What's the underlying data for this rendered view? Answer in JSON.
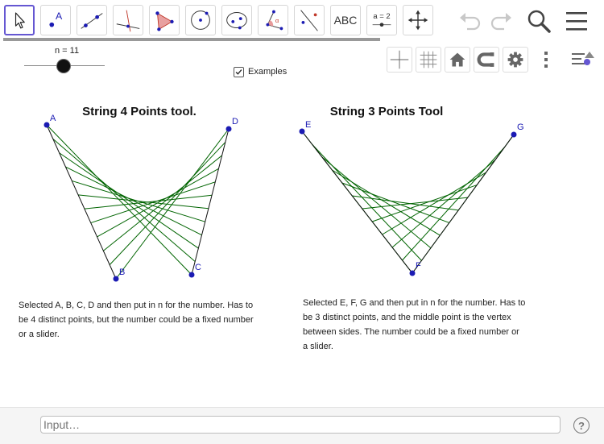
{
  "toolbar": {
    "tools": [
      {
        "name": "move-tool-icon"
      },
      {
        "name": "point-tool-icon",
        "label": "A"
      },
      {
        "name": "line-tool-icon"
      },
      {
        "name": "perpendicular-line-tool-icon"
      },
      {
        "name": "polygon-tool-icon"
      },
      {
        "name": "circle-tool-icon"
      },
      {
        "name": "ellipse-tool-icon"
      },
      {
        "name": "angle-tool-icon",
        "label": "α"
      },
      {
        "name": "reflect-tool-icon"
      },
      {
        "name": "text-tool-icon",
        "label": "ABC"
      },
      {
        "name": "slider-tool-icon",
        "label": "a = 2"
      },
      {
        "name": "move-graphics-view-icon"
      }
    ],
    "progress": 1.0
  },
  "slider": {
    "label": "n = 11",
    "value": 11
  },
  "checkbox": {
    "label": "Examples",
    "checked": true
  },
  "figures": {
    "left": {
      "title": "String 4 Points tool.",
      "points": {
        "A": "A",
        "B": "B",
        "C": "C",
        "D": "D"
      },
      "description": "Selected A, B, C, D and then put in n for the number. Has to be 4 distinct points, but the number could be a fixed number or a slider."
    },
    "right": {
      "title": "String 3 Points Tool",
      "points": {
        "E": "E",
        "F": "F",
        "G": "G"
      },
      "description": "Selected E, F, G and then put in n for the number. Has to be 3 distinct points, and the middle point is the vertex between sides. The number could be a fixed number or a slider."
    }
  },
  "input": {
    "placeholder": "Input…"
  },
  "colors": {
    "accent": "#6557d2",
    "points": "#1b1bb3",
    "strings": "#006400"
  }
}
